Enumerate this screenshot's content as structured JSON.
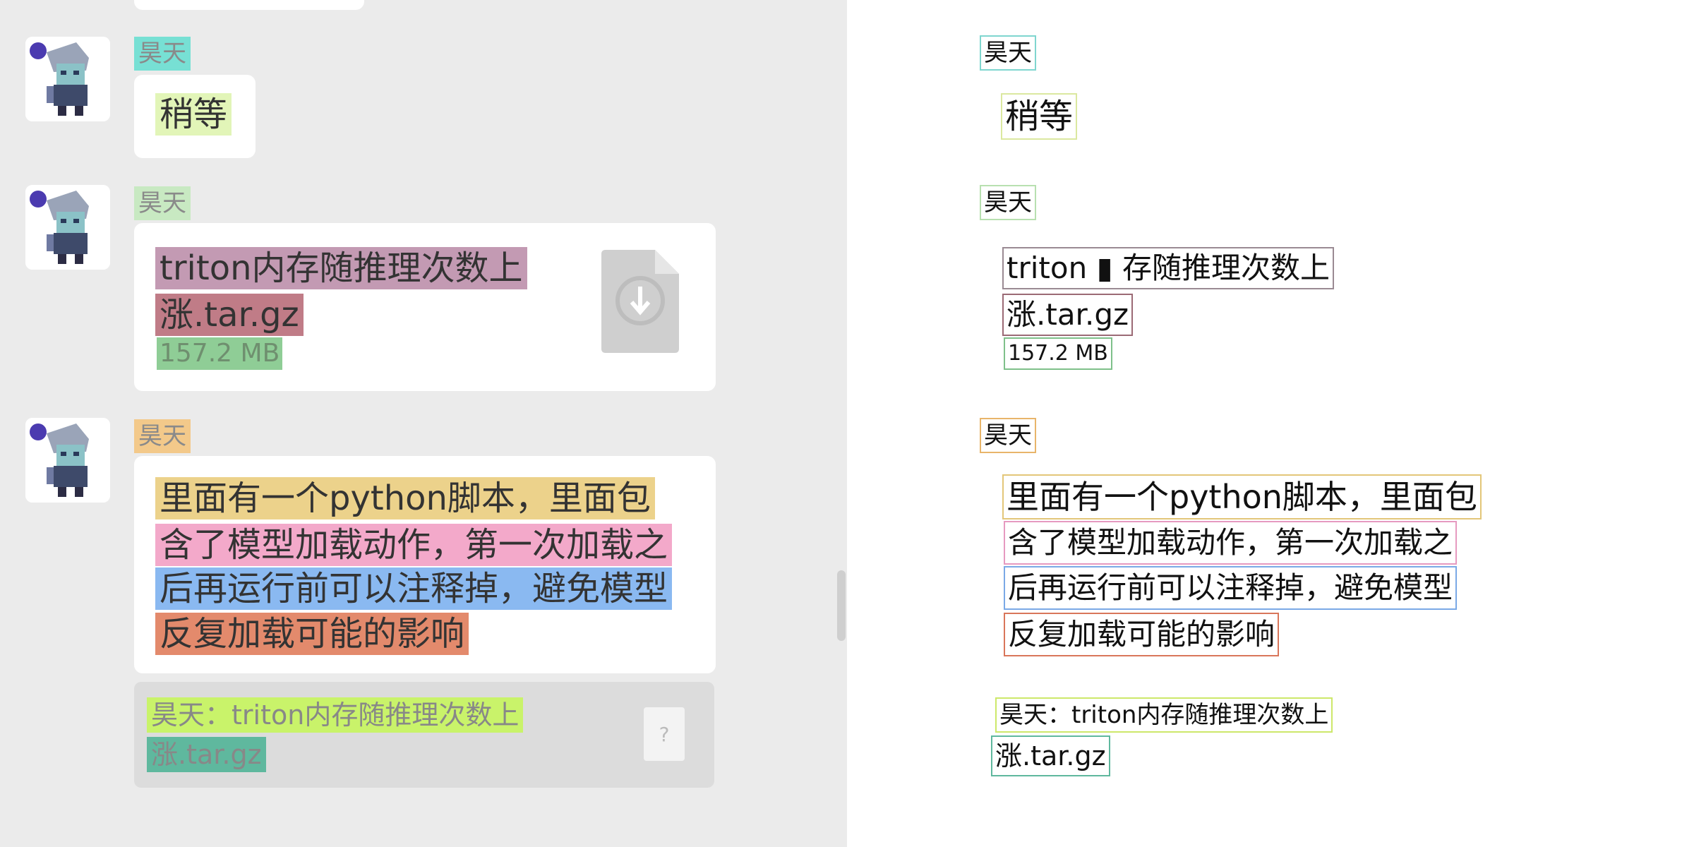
{
  "chat": {
    "messages": [
      {
        "sender": "昊天",
        "text": "稍等"
      },
      {
        "sender": "昊天",
        "file": {
          "name_line1": "triton内存随推理次数上",
          "name_line2": "涨.tar.gz",
          "size": "157.2 MB"
        }
      },
      {
        "sender": "昊天",
        "lines": [
          "里面有一个python脚本，里面包",
          "含了模型加载动作，第一次加载之",
          "后再运行前可以注释掉，避免模型",
          "反复加载可能的影响"
        ],
        "quote": {
          "line1": "昊天：triton内存随推理次数上",
          "line2": "涨.tar.gz",
          "icon_glyph": "?"
        }
      }
    ]
  },
  "ocr": {
    "items": [
      {
        "text": "昊天",
        "color": "#7fd6cf"
      },
      {
        "text": "稍等",
        "color": "#dbe8a0"
      },
      {
        "text": "昊天",
        "color": "#b8e0b0"
      },
      {
        "text": "triton ▮ 存随推理次数上",
        "color": "#9a8a93"
      },
      {
        "text": "涨.tar.gz",
        "color": "#9b6a75"
      },
      {
        "text": "157.2 MB",
        "color": "#7fc08a"
      },
      {
        "text": "昊天",
        "color": "#e8b56a"
      },
      {
        "text": "里面有一个python脚本，里面包",
        "color": "#e3c679"
      },
      {
        "text": "含了模型加载动作，第一次加载之",
        "color": "#e69ac0"
      },
      {
        "text": "后再运行前可以注释掉，避免模型",
        "color": "#7aa9e6"
      },
      {
        "text": "反复加载可能的影响",
        "color": "#d9765a"
      },
      {
        "text": "昊天：triton内存随推理次数上",
        "color": "#cde86a"
      },
      {
        "text": "涨.tar.gz",
        "color": "#5fb89e"
      }
    ]
  },
  "colors": {
    "chat_background": "#ebebeb",
    "bubble": "#ffffff",
    "quote_background": "#dcdcdc"
  }
}
